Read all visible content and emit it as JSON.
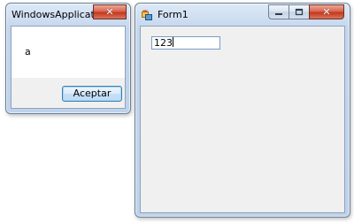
{
  "message_box": {
    "title": "WindowsApplicati...",
    "message": "a",
    "accept_label": "Aceptar",
    "close_glyph": "✕"
  },
  "form1": {
    "title": "Form1",
    "textbox_value": "123",
    "icons": {
      "app": "form-app-icon",
      "minimize": "minimize-icon",
      "maximize": "maximize-icon",
      "close": "close-icon"
    },
    "close_glyph": "✕"
  },
  "colors": {
    "close_button": "#c3371c",
    "form_background": "#f0f0f0",
    "window_frame": "#bed2ea",
    "default_button_border": "#3c7fb1"
  }
}
